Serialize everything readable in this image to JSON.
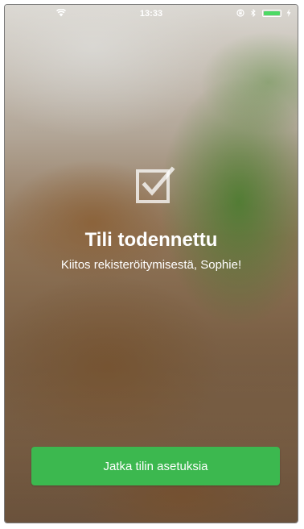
{
  "status_bar": {
    "time": "13:33",
    "battery_color": "#4cd964",
    "icons": [
      "wifi-icon",
      "rotation-lock-icon",
      "bluetooth-icon",
      "battery-icon",
      "charging-icon"
    ]
  },
  "confirmation": {
    "icon": "checkbox-check-icon",
    "title": "Tili todennettu",
    "message": "Kiitos rekisteröitymisestä, Sophie!"
  },
  "action": {
    "label": "Jatka tilin asetuksia",
    "color": "#3cb84f"
  }
}
